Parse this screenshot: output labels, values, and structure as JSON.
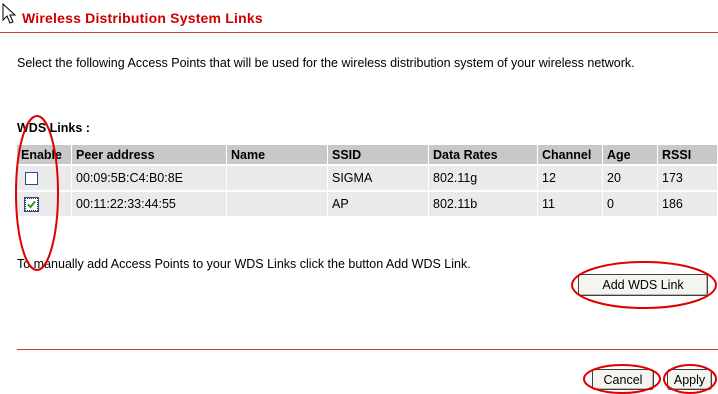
{
  "page": {
    "title": "Wireless Distribution System Links",
    "description": "Select the following Access Points that will be used for the wireless distribution system of your wireless network.",
    "links_label": "WDS Links :",
    "manual_add_text": "To manually add Access Points to your WDS Links click the button Add WDS Link."
  },
  "table": {
    "headers": [
      "Enable",
      "Peer address",
      "Name",
      "SSID",
      "Data Rates",
      "Channel",
      "Age",
      "RSSI"
    ],
    "rows": [
      {
        "enabled": false,
        "peer_address": "00:09:5B:C4:B0:8E",
        "name": "",
        "ssid": "SIGMA",
        "data_rates": "802.11g",
        "channel": "12",
        "age": "20",
        "rssi": "173"
      },
      {
        "enabled": true,
        "peer_address": "00:11:22:33:44:55",
        "name": "",
        "ssid": "AP",
        "data_rates": "802.11b",
        "channel": "11",
        "age": "0",
        "rssi": "186"
      }
    ]
  },
  "buttons": {
    "add_wds_link": "Add WDS Link",
    "cancel": "Cancel",
    "apply": "Apply"
  },
  "colors": {
    "title": "#cc0000",
    "rule": "#c04040",
    "header_bg": "#c8c8c8",
    "row_bg": "#eaeaea",
    "annotation": "#e00000",
    "checkmark": "#2a9a2a"
  },
  "icons": {
    "cursor": "arrow-cursor-icon",
    "checkbox_checked": "checkmark-icon"
  }
}
